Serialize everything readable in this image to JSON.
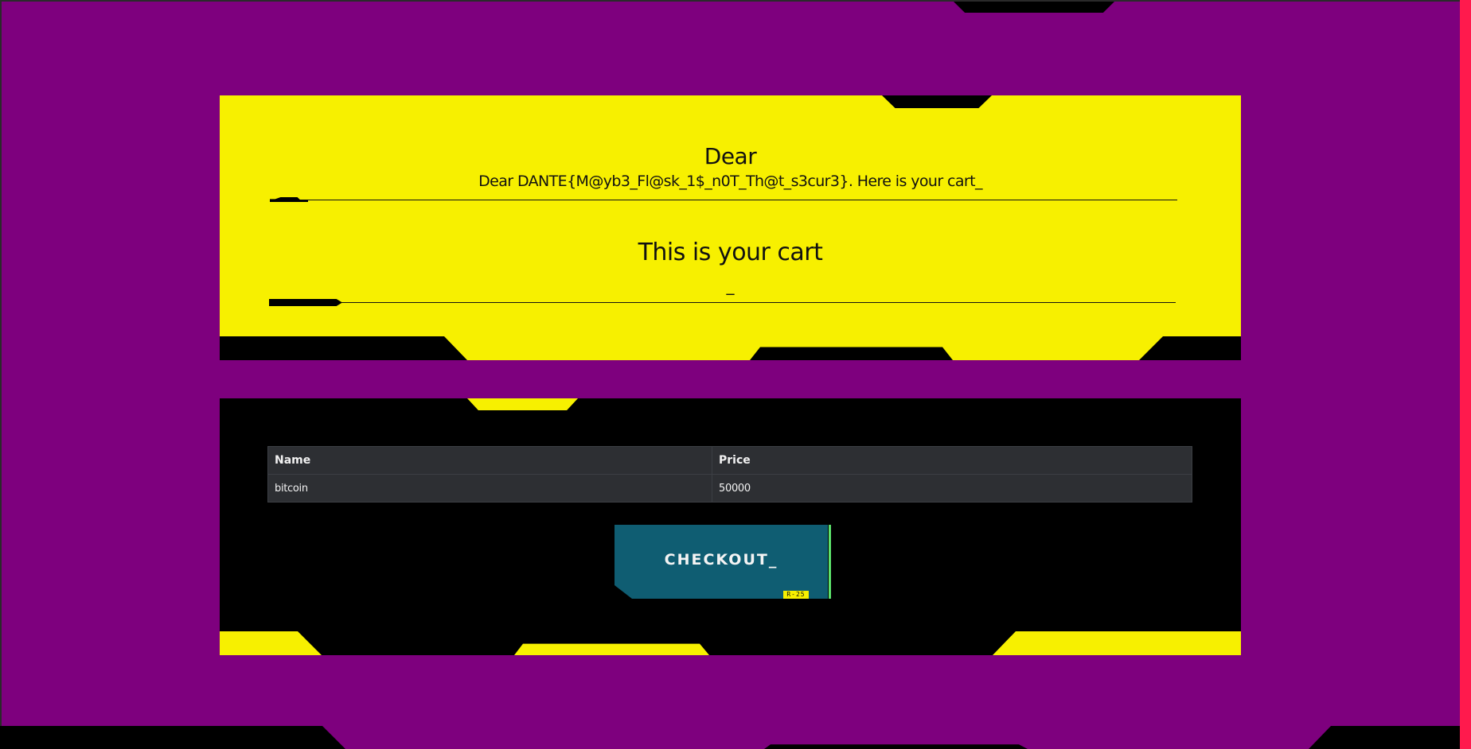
{
  "greeting": {
    "title": "Dear",
    "message": "Dear DANTE{M@yb3_Fl@sk_1$_n0T_Th@t_s3cur3}. Here is your cart_"
  },
  "cart": {
    "heading": "This is your cart",
    "underscore": "_",
    "table": {
      "headers": [
        "Name",
        "Price"
      ],
      "rows": [
        {
          "name": "bitcoin",
          "price": "50000"
        }
      ]
    },
    "checkout": {
      "label": "CHECKOUT_",
      "tag": "R-25"
    }
  },
  "colors": {
    "background": "#7e007e",
    "yellow": "#f7f000",
    "black": "#000000",
    "button": "#0f5d72",
    "button_accent": "#5ce36b",
    "edge": "#ff1a4d",
    "table_bg": "#2d2f33"
  }
}
